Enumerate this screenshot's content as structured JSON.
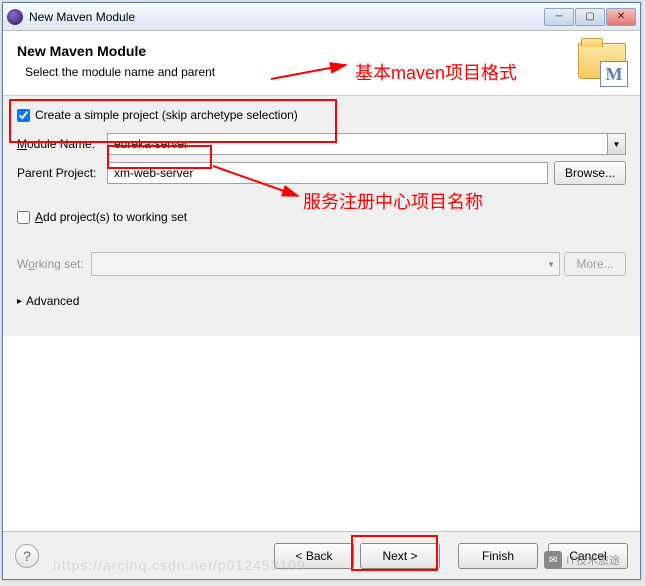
{
  "titlebar": {
    "text": "New Maven Module"
  },
  "header": {
    "title": "New Maven Module",
    "subtitle": "Select the module name and parent"
  },
  "checkbox": {
    "label": "Create a simple project (skip archetype selection)",
    "checked": true
  },
  "fields": {
    "module_name": {
      "label": "Module Name:",
      "value": "eureka-server"
    },
    "parent_project": {
      "label": "Parent Project:",
      "value": "xm-web-server"
    },
    "browse_label": "Browse..."
  },
  "workingset": {
    "add_label": "Add project(s) to working set",
    "checked": false,
    "label": "Working set:",
    "more_label": "More..."
  },
  "advanced": {
    "label": "Advanced"
  },
  "buttons": {
    "back": "< Back",
    "next": "Next >",
    "finish": "Finish",
    "cancel": "Cancel"
  },
  "annotations": {
    "a1": "基本maven项目格式",
    "a2": "服务注册中心项目名称"
  },
  "watermark": {
    "url": "https://arcinq.csdn.net/p012453109",
    "author": "IT技术旅途"
  }
}
